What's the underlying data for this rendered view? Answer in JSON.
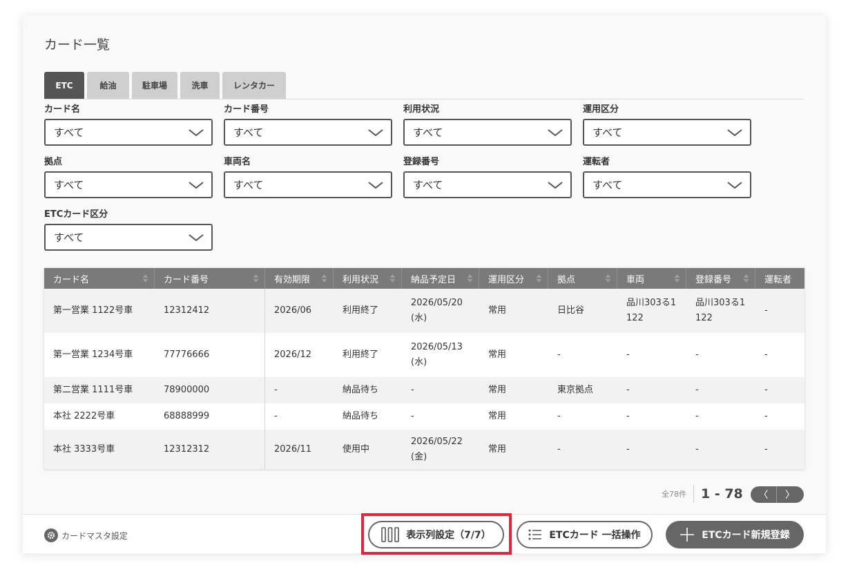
{
  "page": {
    "title": "カード一覧"
  },
  "tabs": [
    {
      "label": "ETC",
      "active": true
    },
    {
      "label": "給油",
      "active": false
    },
    {
      "label": "駐車場",
      "active": false
    },
    {
      "label": "洗車",
      "active": false
    },
    {
      "label": "レンタカー",
      "active": false
    }
  ],
  "filters": [
    {
      "label": "カード名",
      "value": "すべて"
    },
    {
      "label": "カード番号",
      "value": "すべて"
    },
    {
      "label": "利用状況",
      "value": "すべて"
    },
    {
      "label": "運用区分",
      "value": "すべて"
    },
    {
      "label": "拠点",
      "value": "すべて"
    },
    {
      "label": "車両名",
      "value": "すべて"
    },
    {
      "label": "登録番号",
      "value": "すべて"
    },
    {
      "label": "運転者",
      "value": "すべて"
    },
    {
      "label": "ETCカード区分",
      "value": "すべて"
    }
  ],
  "table": {
    "columns": [
      {
        "label": "カード名",
        "sortable": true
      },
      {
        "label": "カード番号",
        "sortable": true
      },
      {
        "label": "有効期限",
        "sortable": true
      },
      {
        "label": "利用状況",
        "sortable": true
      },
      {
        "label": "納品予定日",
        "sortable": true
      },
      {
        "label": "運用区分",
        "sortable": true
      },
      {
        "label": "拠点",
        "sortable": true
      },
      {
        "label": "車両",
        "sortable": true
      },
      {
        "label": "登録番号",
        "sortable": true
      },
      {
        "label": "運転者",
        "sortable": false
      }
    ],
    "rows": [
      [
        "第一営業 1122号車",
        "12312412",
        "2026/06",
        "利用終了",
        "2026/05/20(水)",
        "常用",
        "日比谷",
        "品川303る1122",
        "品川303る1122",
        "-"
      ],
      [
        "第一営業 1234号車",
        "77776666",
        "2026/12",
        "利用終了",
        "2026/05/13(水)",
        "常用",
        "-",
        "-",
        "-",
        "-"
      ],
      [
        "第二営業 1111号車",
        "78900000",
        "-",
        "納品待ち",
        "-",
        "常用",
        "東京拠点",
        "-",
        "-",
        "-"
      ],
      [
        "本社 2222号車",
        "68888999",
        "-",
        "納品待ち",
        "-",
        "常用",
        "-",
        "-",
        "-",
        "-"
      ],
      [
        "本社 3333号車",
        "12312312",
        "2026/11",
        "使用中",
        "2026/05/22(金)",
        "常用",
        "-",
        "-",
        "-",
        "-"
      ]
    ]
  },
  "pagination": {
    "total": "全78件",
    "range": "1 - 78",
    "prev_label": "〈",
    "next_label": "〉"
  },
  "footer": {
    "settings_label": "カードマスタ設定",
    "columns_button": "表示列設定（7/7）",
    "bulk_button": "ETCカード 一括操作",
    "new_button": "ETCカード新規登録"
  },
  "colors": {
    "highlight": "#e0263a",
    "header_bg": "#7a7a7a",
    "button_dark": "#666666"
  }
}
